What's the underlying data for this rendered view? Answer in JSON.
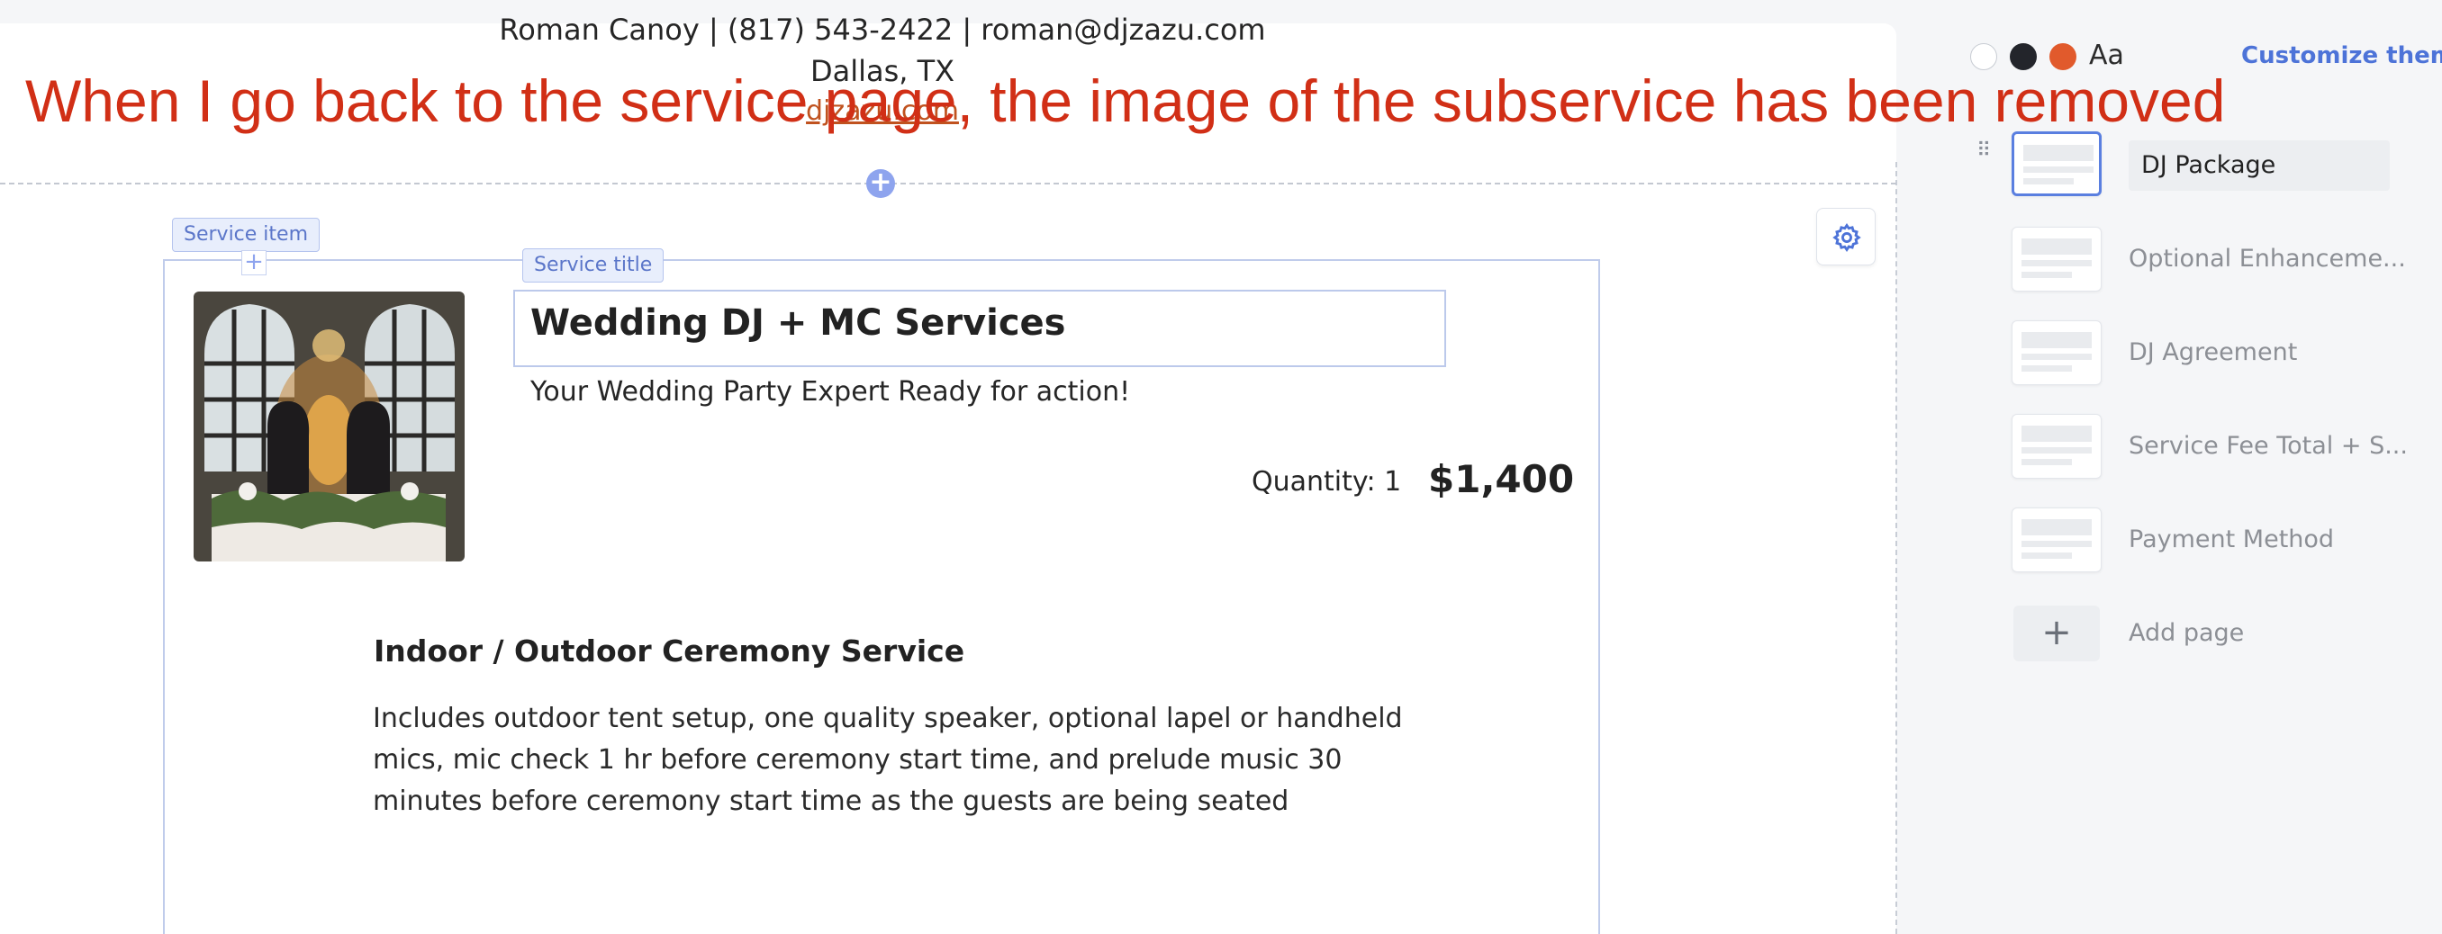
{
  "header": {
    "contact_line": "Roman Canoy | (817) 543-2422 | roman@djzazu.com",
    "location": "Dallas, TX",
    "website": "djzazu.com"
  },
  "annotation": "When I go back to the service page, the image of the subservice has been removed",
  "editor_tags": {
    "service_item": "Service item",
    "service_title": "Service title"
  },
  "service": {
    "title": "Wedding DJ + MC Services",
    "subtitle": "Your Wedding Party Expert Ready for action!",
    "quantity": "Quantity: 1",
    "price": "$1,400",
    "subservice": {
      "heading": "Indoor / Outdoor Ceremony Service",
      "description": "Includes outdoor tent setup, one quality speaker, optional lapel or handheld mics, mic check 1 hr before ceremony start time, and prelude music 30 minutes before ceremony start time as the guests are being seated"
    }
  },
  "theme": {
    "swatches": [
      "#ffffff",
      "#23252b",
      "#e15a2c"
    ],
    "font_label": "Aa",
    "customize_label": "Customize theme"
  },
  "pages": [
    {
      "label": "DJ Package",
      "selected": true
    },
    {
      "label": "Optional Enhanceme...",
      "selected": false
    },
    {
      "label": "DJ Agreement",
      "selected": false
    },
    {
      "label": "Service Fee Total + S...",
      "selected": false
    },
    {
      "label": "Payment Method",
      "selected": false
    }
  ],
  "add_page": {
    "icon": "plus-icon",
    "label": "Add page"
  },
  "colors": {
    "accent": "#4d73d8",
    "annotation": "#d12f16",
    "link": "#c0521f"
  }
}
